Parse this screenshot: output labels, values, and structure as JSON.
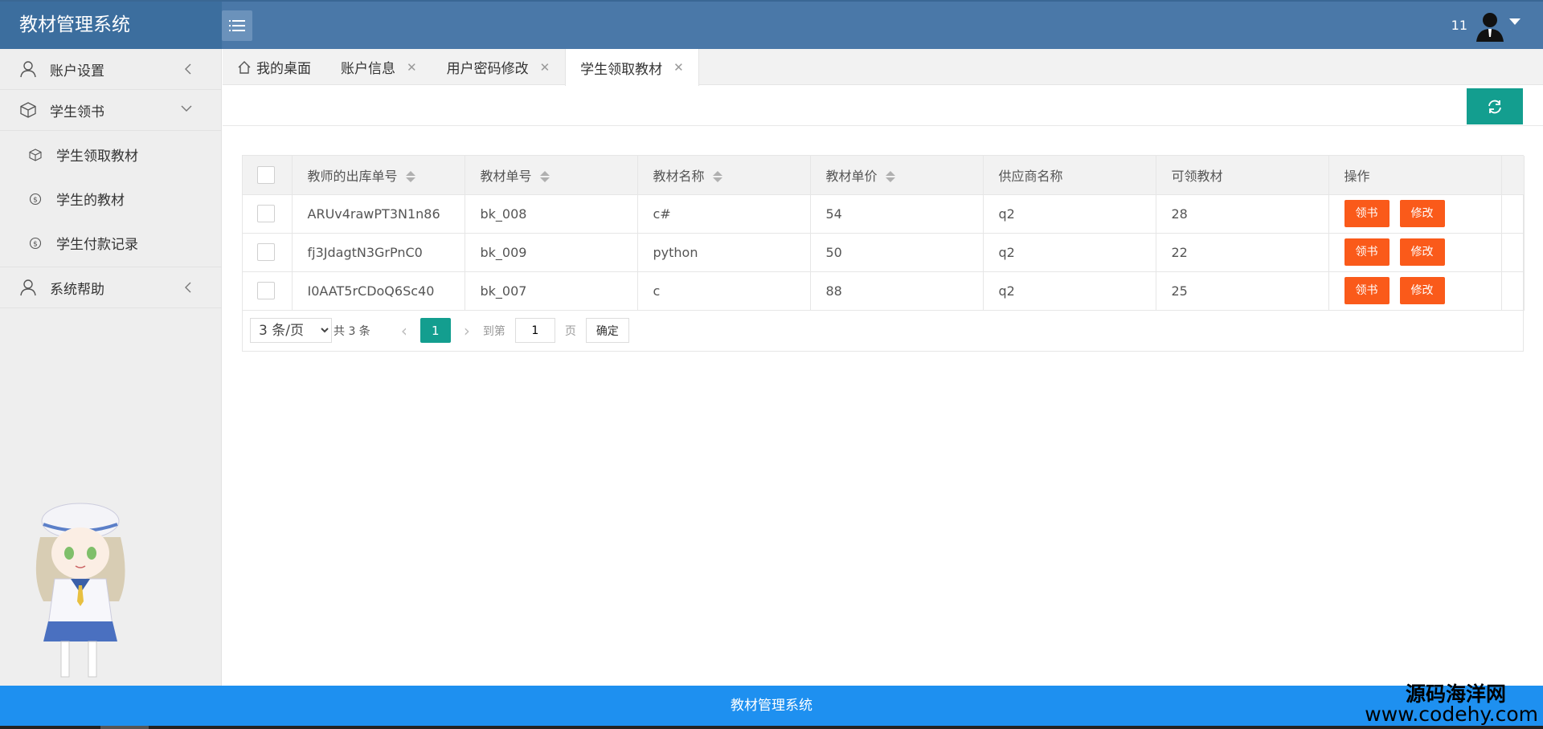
{
  "app": {
    "title": "教材管理系统"
  },
  "header": {
    "user_name": "11"
  },
  "sidebar": {
    "groups": [
      {
        "label": "账户设置",
        "icon": "user-icon",
        "expanded": false
      },
      {
        "label": "学生领书",
        "icon": "cube-icon",
        "expanded": true,
        "items": [
          {
            "label": "学生领取教材",
            "icon": "cube-icon"
          },
          {
            "label": "学生的教材",
            "icon": "dollar-icon"
          },
          {
            "label": "学生付款记录",
            "icon": "dollar-icon"
          }
        ]
      },
      {
        "label": "系统帮助",
        "icon": "user-icon",
        "expanded": false
      }
    ]
  },
  "tabs": [
    {
      "label": "我的桌面",
      "closable": false
    },
    {
      "label": "账户信息",
      "closable": true
    },
    {
      "label": "用户密码修改",
      "closable": true
    },
    {
      "label": "学生领取教材",
      "closable": true,
      "active": true
    }
  ],
  "table": {
    "columns": [
      "教师的出库单号",
      "教材单号",
      "教材名称",
      "教材单价",
      "供应商名称",
      "可领教材",
      "操作"
    ],
    "rows": [
      {
        "order_no": "ARUv4rawPT3N1n86",
        "book_no": "bk_008",
        "name": "c#",
        "price": "54",
        "supplier": "q2",
        "available": "28"
      },
      {
        "order_no": "fj3JdagtN3GrPnC0",
        "book_no": "bk_009",
        "name": "python",
        "price": "50",
        "supplier": "q2",
        "available": "22"
      },
      {
        "order_no": "I0AAT5rCDoQ6Sc40",
        "book_no": "bk_007",
        "name": "c",
        "price": "88",
        "supplier": "q2",
        "available": "25"
      }
    ],
    "actions": {
      "receive": "领书",
      "edit": "修改"
    }
  },
  "pager": {
    "page_size": "3 条/页",
    "page_size_options": [
      "3 条/页"
    ],
    "total": "共 3 条",
    "current_page": "1",
    "goto_label": "到第",
    "goto_value": "1",
    "page_label": "页",
    "confirm": "确定"
  },
  "footer": {
    "text": "教材管理系统"
  },
  "watermark": {
    "line1": "源码海洋网",
    "line2": "www.codehy.com"
  },
  "colors": {
    "header": "#4a78a8",
    "accent": "#139e8f",
    "danger": "#fa5a1a",
    "footer": "#1e90f0"
  }
}
